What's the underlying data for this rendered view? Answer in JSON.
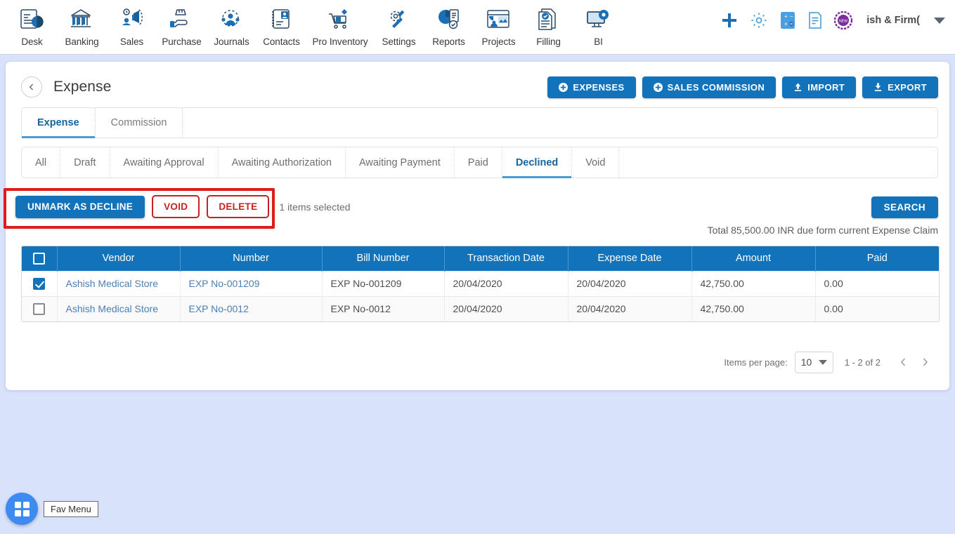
{
  "topnav": {
    "items": [
      {
        "label": "Desk",
        "icon": "dashboard-icon"
      },
      {
        "label": "Banking",
        "icon": "bank-icon"
      },
      {
        "label": "Sales",
        "icon": "megaphone-icon"
      },
      {
        "label": "Purchase",
        "icon": "hand-bag-icon"
      },
      {
        "label": "Journals",
        "icon": "people-gear-icon"
      },
      {
        "label": "Contacts",
        "icon": "contact-card-icon"
      },
      {
        "label": "Pro Inventory",
        "icon": "inventory-cart-icon"
      },
      {
        "label": "Settings",
        "icon": "gear-wrench-icon"
      },
      {
        "label": "Reports",
        "icon": "pie-report-icon"
      },
      {
        "label": "Projects",
        "icon": "projects-board-icon"
      },
      {
        "label": "Filling",
        "icon": "filing-docs-icon"
      },
      {
        "label": "BI",
        "icon": "bi-monitor-icon"
      }
    ],
    "right_icons": [
      {
        "name": "add-plus-icon"
      },
      {
        "name": "settings-gear-icon"
      },
      {
        "name": "calculator-icon"
      },
      {
        "name": "notes-icon"
      },
      {
        "name": "new-badge-icon",
        "text": "NEW"
      }
    ],
    "firm_name": "ish & Firm(",
    "chevron": "chevron-down-icon"
  },
  "page": {
    "title": "Expense",
    "back_icon": "chevron-left-icon"
  },
  "head_actions": [
    {
      "label": "EXPENSES",
      "icon": "plus-circle-icon"
    },
    {
      "label": "SALES COMMISSION",
      "icon": "plus-circle-icon"
    },
    {
      "label": "IMPORT",
      "icon": "upload-icon"
    },
    {
      "label": "EXPORT",
      "icon": "download-icon"
    }
  ],
  "tabs": [
    {
      "label": "Expense",
      "active": true
    },
    {
      "label": "Commission",
      "active": false
    }
  ],
  "subtabs": [
    {
      "label": "All",
      "active": false
    },
    {
      "label": "Draft",
      "active": false
    },
    {
      "label": "Awaiting Approval",
      "active": false
    },
    {
      "label": "Awaiting Authorization",
      "active": false
    },
    {
      "label": "Awaiting Payment",
      "active": false
    },
    {
      "label": "Paid",
      "active": false
    },
    {
      "label": "Declined",
      "active": true
    },
    {
      "label": "Void",
      "active": false
    }
  ],
  "bulk": {
    "unmark_label": "UNMARK AS DECLINE",
    "void_label": "VOID",
    "delete_label": "DELETE",
    "selected_text": "1 items selected",
    "annotation_color": "#e01b1b"
  },
  "search": {
    "label": "SEARCH"
  },
  "total_note": "Total 85,500.00 INR due form current Expense Claim",
  "table": {
    "columns": [
      "Vendor",
      "Number",
      "Bill Number",
      "Transaction Date",
      "Expense Date",
      "Amount",
      "Paid"
    ],
    "header_checkbox_checked": false,
    "rows": [
      {
        "checked": true,
        "vendor": "Ashish Medical Store",
        "number": "EXP No-001209",
        "bill_number": "EXP No-001209",
        "transaction_date": "20/04/2020",
        "expense_date": "20/04/2020",
        "amount": "42,750.00",
        "paid": "0.00"
      },
      {
        "checked": false,
        "vendor": "Ashish Medical Store",
        "number": "EXP No-0012",
        "bill_number": "EXP No-0012",
        "transaction_date": "20/04/2020",
        "expense_date": "20/04/2020",
        "amount": "42,750.00",
        "paid": "0.00"
      }
    ]
  },
  "paginator": {
    "items_per_page_label": "Items per page:",
    "items_per_page_value": "10",
    "range": "1 - 2 of 2",
    "prev_icon": "chevron-left-icon",
    "next_icon": "chevron-right-icon"
  },
  "fab": {
    "icon": "grid-menu-icon",
    "tooltip": "Fav Menu"
  },
  "colors": {
    "accent": "#1273ba",
    "danger": "#c62222",
    "page_bg": "#d8e2fb"
  }
}
